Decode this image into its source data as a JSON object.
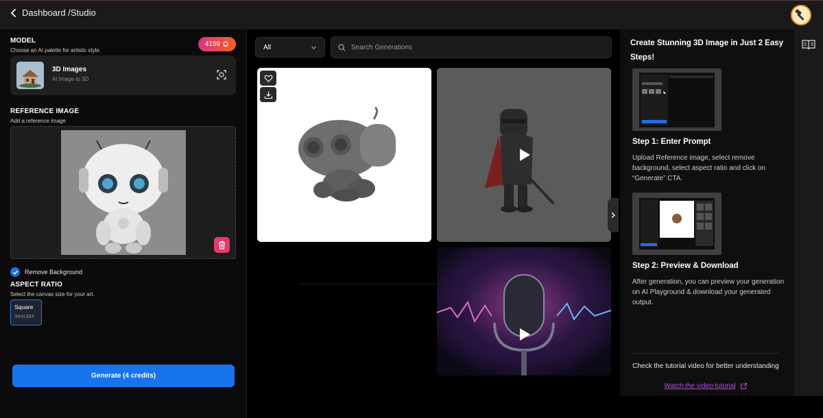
{
  "header": {
    "breadcrumb": "Dashboard /Studio"
  },
  "model": {
    "title": "MODEL",
    "subtitle": "Choose an AI palette for artistic style.",
    "credits": "4159",
    "name": "3D Images",
    "description": "AI Image to 3D"
  },
  "reference": {
    "title": "REFERENCE IMAGE",
    "subtitle": "Add a reference image",
    "remove_background_label": "Remove Background",
    "remove_background_checked": true
  },
  "aspect": {
    "title": "ASPECT RATIO",
    "subtitle": "Select the canvas size for your art.",
    "options": [
      {
        "name": "Square",
        "size": "384x384",
        "selected": true
      }
    ]
  },
  "generate_label": "Generate (4 credits)",
  "gallery": {
    "filter_value": "All",
    "search_placeholder": "Search Generations"
  },
  "guide": {
    "title": "Create Stunning 3D Image in Just 2 Easy Steps!",
    "step1_title": "Step 1: Enter Prompt",
    "step1_desc": "Upload Reference image, select remove background, select aspect ratio and click on “Generate” CTA.",
    "step2_title": "Step 2: Preview & Download",
    "step2_desc": "After generation, you can preview your generation on AI Playground & download your generated output.",
    "help_text": "Check the tutorial video for better understanding",
    "link_text": "Watch the video tutorial"
  },
  "colors": {
    "accent": "#1774ed",
    "delete": "#e73a6c",
    "link": "#a855d8"
  }
}
